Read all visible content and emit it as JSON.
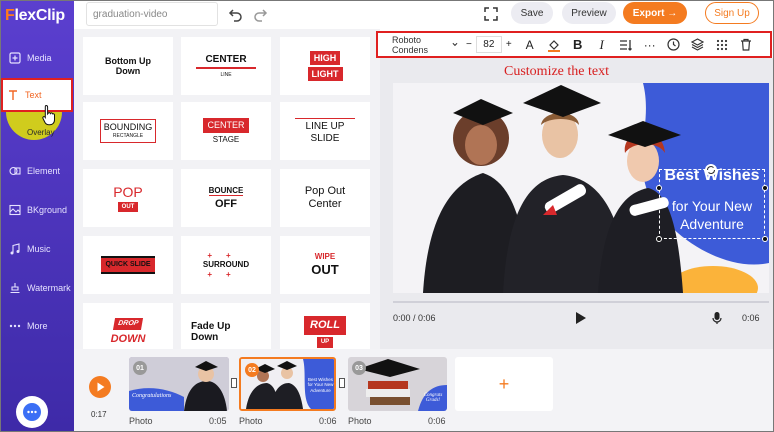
{
  "app": {
    "logo_f": "F",
    "logo_rest": "lexClip"
  },
  "sidebar": {
    "items": [
      {
        "label": "Media",
        "icon": "media-plus-icon"
      },
      {
        "label": "Text",
        "icon": "text-t-icon"
      },
      {
        "label": "Overlay",
        "icon": "overlay-icon"
      },
      {
        "label": "Element",
        "icon": "element-icon"
      },
      {
        "label": "BKground",
        "icon": "background-icon"
      },
      {
        "label": "Music",
        "icon": "music-icon"
      },
      {
        "label": "Watermark",
        "icon": "watermark-icon"
      },
      {
        "label": "More",
        "icon": "more-dots-icon"
      }
    ]
  },
  "topbar": {
    "project_name": "graduation-video",
    "save": "Save",
    "preview": "Preview",
    "export": "Export",
    "export_arrow": "→",
    "signup": "Sign Up"
  },
  "text_templates": [
    {
      "line1": "Bottom Up",
      "line2": "Down"
    },
    {
      "line1": "CENTER",
      "line2": "LINE"
    },
    {
      "line1": "HIGH",
      "line2": "LIGHT"
    },
    {
      "line1": "BOUNDING",
      "line2": "RECTANGLE"
    },
    {
      "line1": "CENTER",
      "line2": "STAGE"
    },
    {
      "line1": "LINE UP",
      "line2": "SLIDE"
    },
    {
      "line1": "POP",
      "line2": "OUT"
    },
    {
      "line1": "BOUNCE",
      "line2": "OFF"
    },
    {
      "line1": "Pop Out",
      "line2": "Center"
    },
    {
      "line1": "QUICK SLIDE",
      "line2": ""
    },
    {
      "line1": "SURROUND",
      "line2": ""
    },
    {
      "line1": "WIPE",
      "line2": "OUT"
    },
    {
      "line1": "DROP",
      "line2": "DOWN"
    },
    {
      "line1": "Fade Up",
      "line2": "Down"
    },
    {
      "line1": "ROLL",
      "line2": "UP"
    }
  ],
  "toolbar": {
    "font": "Roboto Condens",
    "minus": "−",
    "size": "82",
    "plus": "+",
    "text_color": "A",
    "bold": "B",
    "italic": "I",
    "more": "···"
  },
  "annotation": "Customize the text",
  "canvas": {
    "line1": "Best Wishes",
    "line2": "for Your New",
    "line3": "Adventure"
  },
  "player": {
    "current": "0:00 / 0:06",
    "total": "0:06"
  },
  "timeline": {
    "total_time": "0:17",
    "clips": [
      {
        "num": "01",
        "label": "Photo",
        "duration": "0:05",
        "caption": "Congratulations"
      },
      {
        "num": "02",
        "label": "Photo",
        "duration": "0:06",
        "caption": "Best Wishes for Your New Adventure"
      },
      {
        "num": "03",
        "label": "Photo",
        "duration": "0:06",
        "caption": "Congrats Grads!"
      }
    ],
    "add": "+"
  },
  "colors": {
    "accent": "#f47b20",
    "sidebar": "#4b33bf",
    "highlight": "#e02020"
  }
}
